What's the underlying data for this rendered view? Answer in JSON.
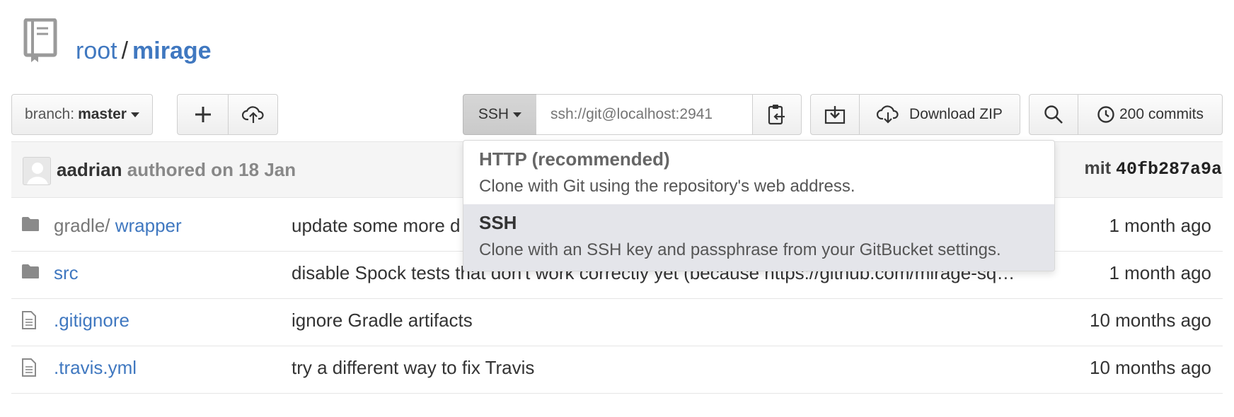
{
  "repo": {
    "owner": "root",
    "separator": "/",
    "name": "mirage"
  },
  "toolbar": {
    "branch_label": "branch:",
    "branch_value": "master",
    "clone_protocol": "SSH",
    "clone_url": "ssh://git@localhost:2941",
    "download_zip": "Download ZIP",
    "commits_count": "200 commits"
  },
  "last_commit": {
    "author": "aadrian",
    "authored": "authored on 18 Jan",
    "label": "mit",
    "hash": "40fb287a9a"
  },
  "clone_menu": [
    {
      "title": "HTTP (recommended)",
      "description": "Clone with Git using the repository's web address.",
      "active": false
    },
    {
      "title": "SSH",
      "description": "Clone with an SSH key and passphrase from your GitBucket settings.",
      "active": true
    }
  ],
  "files": [
    {
      "type": "folder",
      "dir": "gradle/",
      "name": "wrapper",
      "message": "update some more d",
      "age": "1 month ago"
    },
    {
      "type": "folder",
      "dir": "",
      "name": "src",
      "message": "disable Spock tests that don't work correctly yet (because https://github.com/mirage-sq…",
      "age": "1 month ago"
    },
    {
      "type": "file",
      "dir": "",
      "name": ".gitignore",
      "message": "ignore Gradle artifacts",
      "age": "10 months ago"
    },
    {
      "type": "file",
      "dir": "",
      "name": ".travis.yml",
      "message": "try a different way to fix Travis",
      "age": "10 months ago"
    }
  ],
  "colors": {
    "link": "#4078c0",
    "active_menu_bg": "#e4e5ea",
    "commit_bar_bg": "#f5f5f5"
  },
  "icons": [
    "book-icon",
    "plus-icon",
    "cloud-upload-icon",
    "caret-down-icon",
    "clipboard-icon",
    "download-icon",
    "cloud-download-icon",
    "search-icon",
    "history-icon",
    "folder-icon",
    "file-icon"
  ]
}
